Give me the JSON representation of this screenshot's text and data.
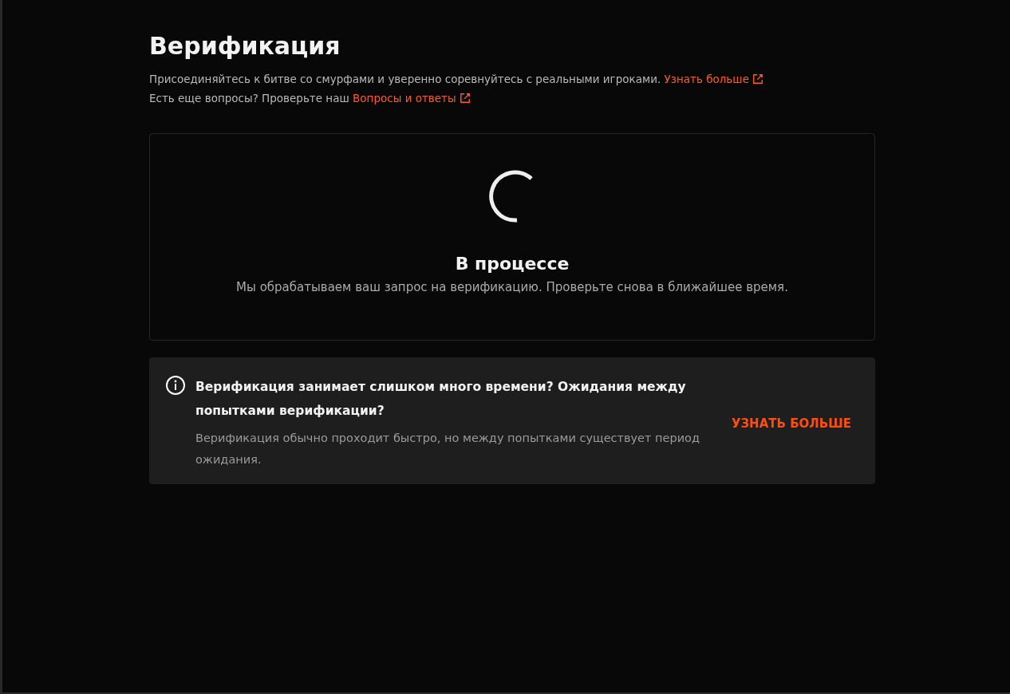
{
  "title": "Верификация",
  "intro": [
    {
      "text": "Присоединяйтесь к битве со смурфами и уверенно соревнуйтесь с реальными игроками.",
      "link": "Узнать больше"
    },
    {
      "text": "Есть еще вопросы? Проверьте наш",
      "link": "Вопросы и ответы"
    }
  ],
  "status_card": {
    "heading": "В процессе",
    "message": "Мы обрабатываем ваш запрос на верификацию. Проверьте снова в ближайшее время."
  },
  "notice": {
    "heading": "Верификация занимает слишком много времени? Ожидания между попытками верификации?",
    "body": "Верификация обычно проходит быстро, но между попытками существует период ожидания.",
    "action": "УЗНАТЬ БОЛЬШЕ"
  }
}
